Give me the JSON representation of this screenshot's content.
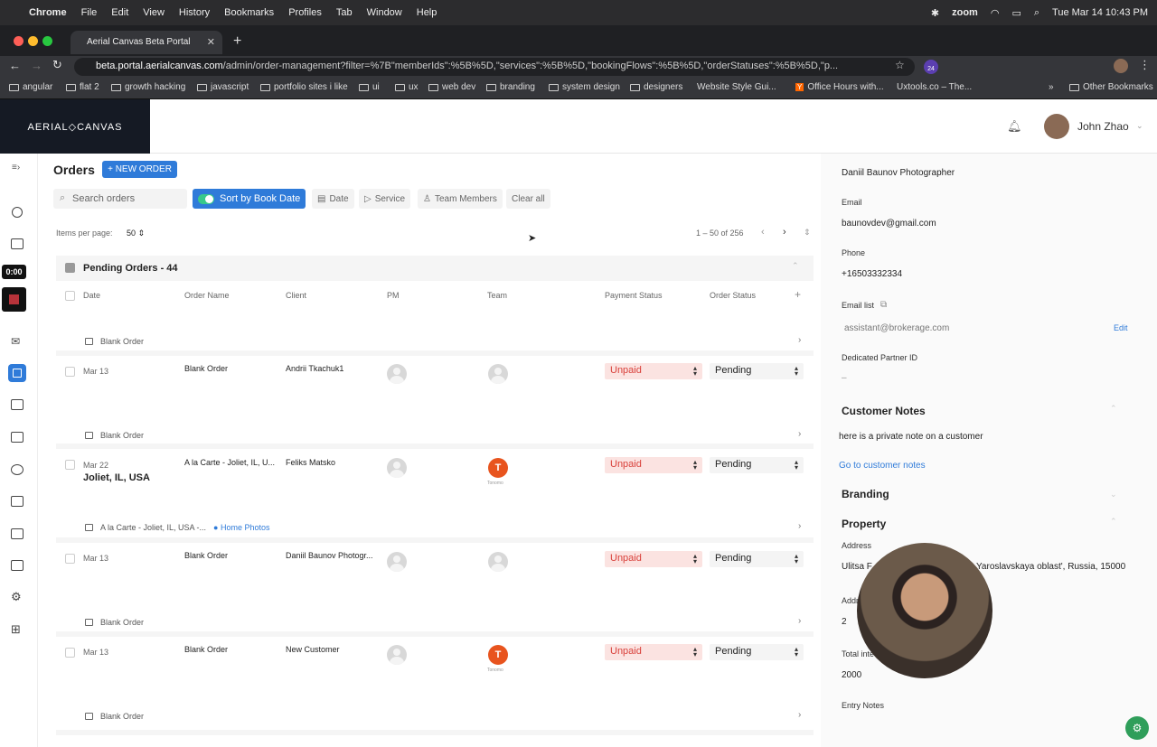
{
  "menubar": {
    "apple": "",
    "app": "Chrome",
    "items": [
      "File",
      "Edit",
      "View",
      "History",
      "Bookmarks",
      "Profiles",
      "Tab",
      "Window",
      "Help"
    ],
    "zoom": "zoom",
    "datetime": "Tue Mar 14  10:43 PM"
  },
  "browser": {
    "tab_title": "Aerial Canvas Beta Portal",
    "url_host": "beta.portal.aerialcanvas.com",
    "url_path": "/admin/order-management?filter=%7B\"memberIds\":%5B%5D,\"services\":%5B%5D,\"bookingFlows\":%5B%5D,\"orderStatuses\":%5B%5D,\"p...",
    "badge": "24"
  },
  "bookmarks": [
    "angular",
    "flat 2",
    "growth hacking",
    "javascript",
    "portfolio sites i like",
    "ui",
    "ux",
    "web dev",
    "branding",
    "system design",
    "designers",
    "Website Style Gui...",
    "Office Hours with...",
    "Uxtools.co – The...",
    "»",
    "Other Bookmarks"
  ],
  "header": {
    "logo": "AERIAL◇CANVAS",
    "user": "John Zhao"
  },
  "sidebar": {
    "timer": "0:00"
  },
  "orders": {
    "title": "Orders",
    "new_order": "+ NEW ORDER",
    "search_placeholder": "Search orders",
    "sort_toggle": "Sort by Book Date",
    "filters": [
      "Date",
      "Service",
      "Team Members",
      "Clear all"
    ],
    "per_page_label": "Items per page:",
    "per_page": "50",
    "range": "1 – 50 of 256",
    "group": "Pending Orders - 44",
    "columns": [
      "Date",
      "Order Name",
      "Client",
      "PM",
      "Team",
      "Payment Status",
      "Order Status"
    ],
    "first_sub": "Blank Order",
    "rows": [
      {
        "date": "Mar 13",
        "location": "",
        "name": "Blank Order",
        "client": "Andrii Tkachuk1",
        "team": "",
        "team_label": "",
        "payment": "Unpaid",
        "status": "Pending",
        "sub": "Blank Order",
        "tag": ""
      },
      {
        "date": "Mar 22",
        "location": "Joliet, IL, USA",
        "name": "A la Carte - Joliet, IL, U...",
        "client": "Feliks Matsko",
        "team": "T",
        "team_label": "Tonomo",
        "payment": "Unpaid",
        "status": "Pending",
        "sub": "A la Carte - Joliet, IL, USA -...",
        "tag": "Home Photos"
      },
      {
        "date": "Mar 13",
        "location": "",
        "name": "Blank Order",
        "client": "Daniil Baunov Photogr...",
        "team": "",
        "team_label": "",
        "payment": "Unpaid",
        "status": "Pending",
        "sub": "Blank Order",
        "tag": ""
      },
      {
        "date": "Mar 13",
        "location": "",
        "name": "Blank Order",
        "client": "New Customer",
        "team": "T",
        "team_label": "Tonomo",
        "payment": "Unpaid",
        "status": "Pending",
        "sub": "Blank Order",
        "tag": ""
      }
    ]
  },
  "detail": {
    "company": "Daniil Baunov Photographer",
    "email_label": "Email",
    "email": "baunovdev@gmail.com",
    "phone_label": "Phone",
    "phone": "+16503332334",
    "email_list_label": "Email list",
    "email_list": "assistant@brokerage.com",
    "edit": "Edit",
    "partner_label": "Dedicated Partner ID",
    "partner": "–",
    "notes_title": "Customer Notes",
    "note": "here is a private note on a customer",
    "notes_link": "Go to customer notes",
    "branding": "Branding",
    "property": "Property",
    "address_label": "Address",
    "address_left": "Ulitsa F",
    "address_right": "Yaroslavskaya oblast', Russia, 15000",
    "addr2_label": "Addr",
    "addr2": "2",
    "total_label": "Total inte",
    "total": "2000",
    "entry_label": "Entry Notes"
  }
}
